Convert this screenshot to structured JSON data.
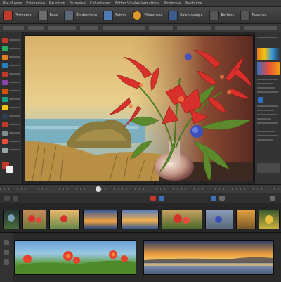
{
  "menu": {
    "items": [
      "Bix of Aww",
      "Ertonesian",
      "Pxusition",
      "Frumelee",
      "Cehostasurt",
      "Fotlon Vinelas Vamatione",
      "Prcsionve",
      "Puolfaime"
    ]
  },
  "toolbar": {
    "buttons": [
      {
        "name": "new-file-icon",
        "color": "#c0392b"
      },
      {
        "name": "brush-icon",
        "color": "#6d6d6d"
      },
      {
        "name": "layers-icon",
        "color": "#5a6a7a"
      },
      {
        "name": "image-icon",
        "color": "#4f7bb5"
      },
      {
        "name": "folder-icon",
        "color": "#8a7a5a"
      },
      {
        "name": "palette-icon",
        "color": "#d99a2b"
      },
      {
        "name": "camera-icon",
        "color": "#3b5b8f"
      },
      {
        "name": "effects-icon",
        "color": "#6a6a6a"
      },
      {
        "name": "export-icon",
        "color": "#6a6a6a"
      }
    ],
    "labels": [
      "Pirlmome",
      "Faoa",
      "Zmdinnlenn",
      "Feimn",
      "Ptlunnesu",
      "Sulen Acstpo",
      "Eerlons",
      "Fuacnos"
    ]
  },
  "colors": {
    "accent": "#3d6fb5",
    "panel_bg": "#2b2b2b",
    "petal_red": "#d8312c",
    "sky_yellow": "#e8c873",
    "sea_blue": "#6aa9c4"
  },
  "filmstrip": {
    "thumbs": [
      {
        "name": "thumb-flowers-dark"
      },
      {
        "name": "thumb-red-flowers"
      },
      {
        "name": "thumb-sunset-coast"
      },
      {
        "name": "thumb-sunset-sea"
      },
      {
        "name": "thumb-sunset-sky"
      },
      {
        "name": "thumb-flower-bouquet"
      },
      {
        "name": "thumb-vase-blue"
      },
      {
        "name": "thumb-golden-field"
      },
      {
        "name": "thumb-yellow-flower"
      }
    ]
  }
}
